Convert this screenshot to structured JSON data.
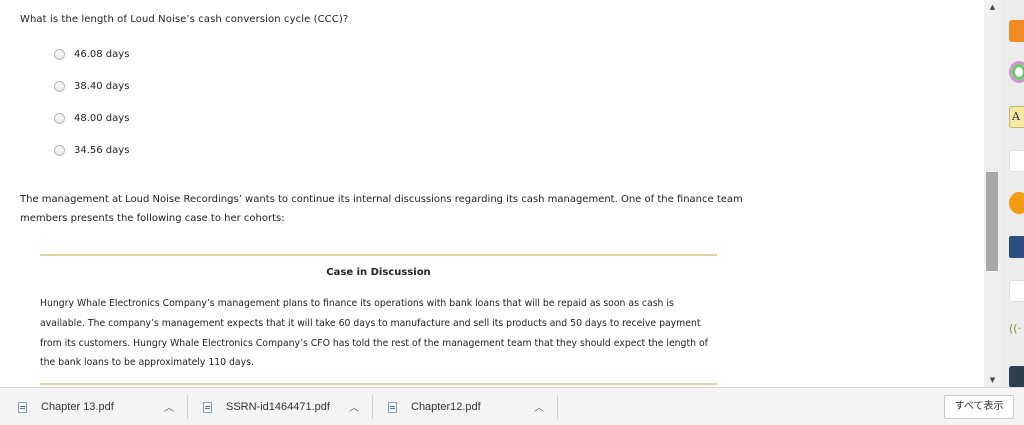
{
  "question": {
    "text": "What is the length of Loud Noise’s cash conversion cycle (CCC)?",
    "options": [
      "46.08 days",
      "38.40 days",
      "48.00 days",
      "34.56 days"
    ]
  },
  "paragraph": "The management at Loud Noise Recordings’ wants to continue its internal discussions regarding its cash management. One of the finance team members presents the following case to her cohorts:",
  "case": {
    "title": "Case in Discussion",
    "body": "Hungry Whale Electronics Company’s management plans to finance its operations with bank loans that will be repaid as soon as cash is available. The company’s management expects that it will take 60 days to manufacture and sell its products and 50 days to receive payment from its customers. Hungry Whale Electronics Company’s CFO has told the rest of the management team that they should expect the length of the bank loans to be approximately 110 days."
  },
  "downloads": {
    "items": [
      {
        "name": "Chapter 13.pdf",
        "icon": "pdf-file-icon"
      },
      {
        "name": "SSRN-id1464471.pdf",
        "icon": "pdf-file-icon"
      },
      {
        "name": "Chapter12.pdf",
        "icon": "pdf-file-icon"
      }
    ],
    "show_all_label": "すべて表示"
  },
  "scrollbar": {
    "up_icon": "scroll-up-arrow-icon",
    "down_icon": "scroll-down-arrow-icon"
  },
  "dock": {
    "items": [
      "rss-feed-icon",
      "color-wheel-icon",
      "font-size-icon",
      "office-app-icon",
      "browser-app-icon",
      "book-icon",
      "note-app-icon",
      "wireless-icon",
      "mountain-icon"
    ]
  },
  "colors": {
    "case_rule": "#ddd1ab",
    "scroll_thumb": "#a8a8a8"
  }
}
